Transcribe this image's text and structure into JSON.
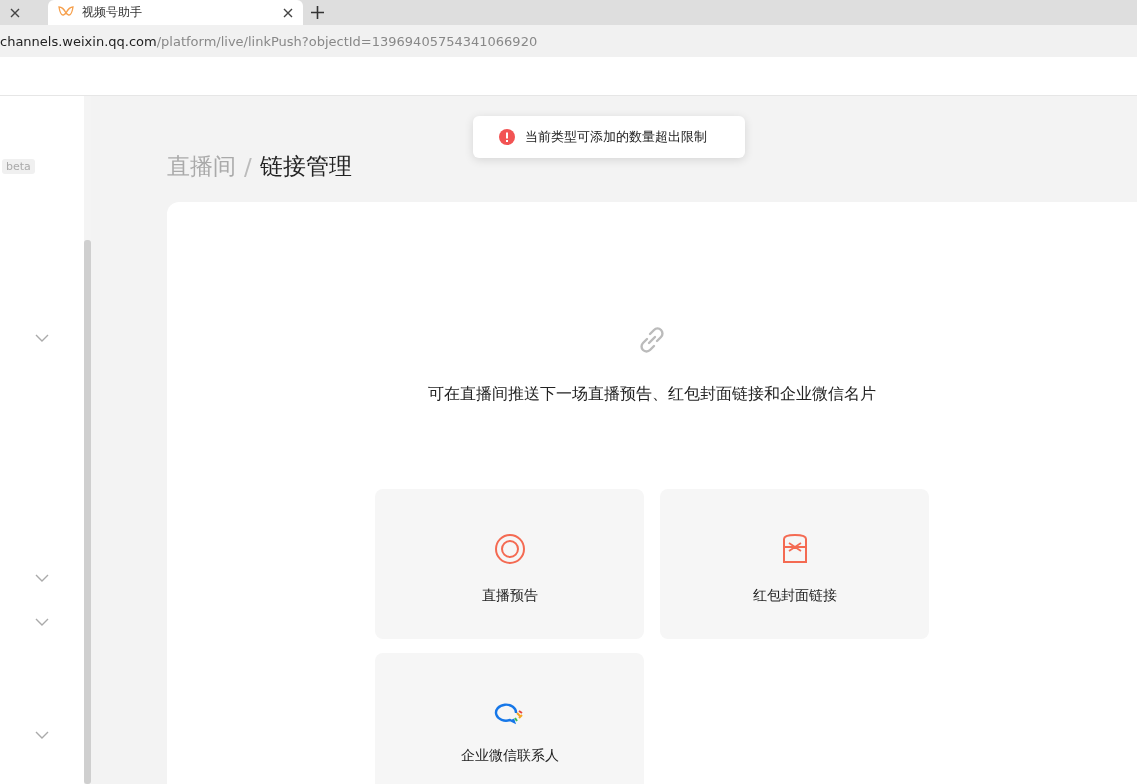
{
  "browser": {
    "tabs": [
      {
        "selected": false
      },
      {
        "title": "视频号助手",
        "selected": true
      }
    ],
    "url": {
      "host": "channels.weixin.qq.com",
      "path": "/platform/live/linkPush?objectId=13969405754341066920"
    }
  },
  "sidebar": {
    "badge": "beta",
    "groups": [
      {
        "expanded": false
      },
      {
        "expanded": false
      },
      {
        "expanded": false
      },
      {
        "expanded": false
      }
    ]
  },
  "toast": {
    "kind": "error",
    "message": "当前类型可添加的数量超出限制"
  },
  "breadcrumb": {
    "separator": "/",
    "items": [
      "直播间",
      "链接管理"
    ]
  },
  "empty_state": {
    "description": "可在直播间推送下一场直播预告、红包封面链接和企业微信名片"
  },
  "options": [
    {
      "kind": "live",
      "label": "直播预告"
    },
    {
      "kind": "envelope",
      "label": "红包封面链接"
    },
    {
      "kind": "contact",
      "label": "企业微信联系人"
    }
  ]
}
